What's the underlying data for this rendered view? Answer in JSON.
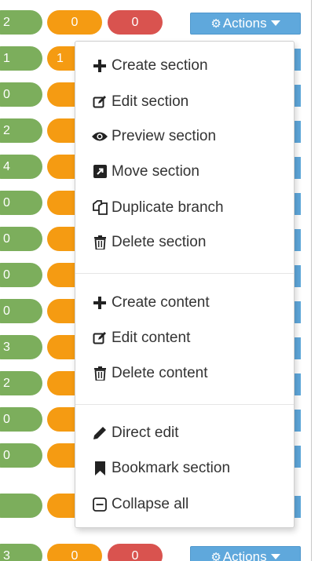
{
  "rows": [
    {
      "green": "2",
      "orange": "0",
      "red": "0",
      "actions_label": "Actions"
    },
    {
      "green": "1",
      "orange": "1"
    },
    {
      "green": "0"
    },
    {
      "green": "2"
    },
    {
      "green": "4"
    },
    {
      "green": "0"
    },
    {
      "green": "0"
    },
    {
      "green": "0"
    },
    {
      "green": "0"
    },
    {
      "green": "3"
    },
    {
      "green": "2"
    },
    {
      "green": "0"
    },
    {
      "green": "0"
    },
    {
      "green": "3",
      "orange": "0",
      "red": "0",
      "actions_label": "Actions"
    }
  ],
  "menu": {
    "section_group": [
      {
        "label": "Create section",
        "icon": "plus-icon"
      },
      {
        "label": "Edit section",
        "icon": "edit-icon"
      },
      {
        "label": "Preview section",
        "icon": "eye-icon"
      },
      {
        "label": "Move section",
        "icon": "move-icon"
      },
      {
        "label": "Duplicate branch",
        "icon": "duplicate-icon"
      },
      {
        "label": "Delete section",
        "icon": "trash-icon"
      }
    ],
    "content_group": [
      {
        "label": "Create content",
        "icon": "plus-icon"
      },
      {
        "label": "Edit content",
        "icon": "edit-icon"
      },
      {
        "label": "Delete content",
        "icon": "trash-icon"
      }
    ],
    "other_group": [
      {
        "label": "Direct edit",
        "icon": "pencil-icon"
      },
      {
        "label": "Bookmark section",
        "icon": "bookmark-icon"
      },
      {
        "label": "Collapse all",
        "icon": "collapse-icon"
      }
    ]
  },
  "colors": {
    "green": "#7cae5c",
    "orange": "#f59b12",
    "red": "#d9534f",
    "actions_blue": "#5fa8dc"
  }
}
